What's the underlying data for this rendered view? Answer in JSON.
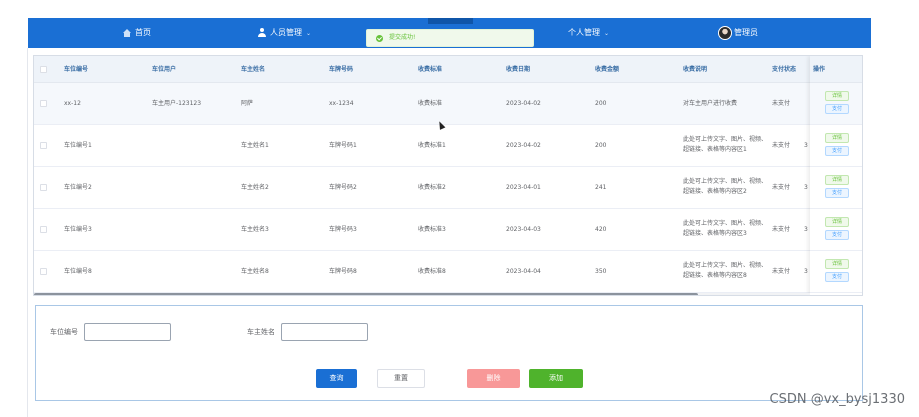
{
  "nav": {
    "home": "首页",
    "person_mgmt": "人员管理",
    "personal_mgmt": "个人管理",
    "admin": "管理员"
  },
  "toast": {
    "message": "提交成功!"
  },
  "table": {
    "headers": {
      "space_no": "车位编号",
      "space_user": "车位用户",
      "owner_name": "车主姓名",
      "plate_no": "车牌号码",
      "fee_std": "收费标准",
      "fee_date": "收费日期",
      "amount": "收费金额",
      "desc": "收费说明",
      "pay_status": "支付状态",
      "op": "操作"
    },
    "rows": [
      {
        "space_no": "xx-12",
        "space_user": "车主用户-123123",
        "owner_name": "阿萨",
        "plate_no": "xx-1234",
        "fee_std": "收费标准",
        "fee_date": "2023-04-02",
        "amount": "200",
        "desc": "对车主用户进行收费",
        "pay_status": "未支付",
        "extra": "",
        "detail": "详情",
        "pay": "支付"
      },
      {
        "space_no": "车位编号1",
        "space_user": "",
        "owner_name": "车主姓名1",
        "plate_no": "车牌号码1",
        "fee_std": "收费标准1",
        "fee_date": "2023-04-02",
        "amount": "200",
        "desc": "此处可上传文字、图片、视频、超链接、表格等内容区1",
        "pay_status": "未支付",
        "extra": "3",
        "detail": "详情",
        "pay": "支付"
      },
      {
        "space_no": "车位编号2",
        "space_user": "",
        "owner_name": "车主姓名2",
        "plate_no": "车牌号码2",
        "fee_std": "收费标准2",
        "fee_date": "2023-04-01",
        "amount": "241",
        "desc": "此处可上传文字、图片、视频、超链接、表格等内容区2",
        "pay_status": "未支付",
        "extra": "3",
        "detail": "详情",
        "pay": "支付"
      },
      {
        "space_no": "车位编号3",
        "space_user": "",
        "owner_name": "车主姓名3",
        "plate_no": "车牌号码3",
        "fee_std": "收费标准3",
        "fee_date": "2023-04-03",
        "amount": "420",
        "desc": "此处可上传文字、图片、视频、超链接、表格等内容区3",
        "pay_status": "未支付",
        "extra": "3",
        "detail": "详情",
        "pay": "支付"
      },
      {
        "space_no": "车位编号8",
        "space_user": "",
        "owner_name": "车主姓名8",
        "plate_no": "车牌号码8",
        "fee_std": "收费标准8",
        "fee_date": "2023-04-04",
        "amount": "350",
        "desc": "此处可上传文字、图片、视频、超链接、表格等内容区8",
        "pay_status": "未支付",
        "extra": "3",
        "detail": "详情",
        "pay": "支付"
      }
    ]
  },
  "search": {
    "space_no_label": "车位编号",
    "space_no_value": "",
    "owner_name_label": "车主姓名",
    "owner_name_value": "",
    "query": "查询",
    "reset": "重置",
    "delete": "删除",
    "add": "添加"
  },
  "watermark": "CSDN @vx_bysj1330",
  "colors": {
    "nav_bg": "#1a6fd4",
    "success": "#67c23a",
    "primary": "#1a6fd4",
    "danger_light": "#f89898",
    "add_green": "#4fb32c"
  }
}
